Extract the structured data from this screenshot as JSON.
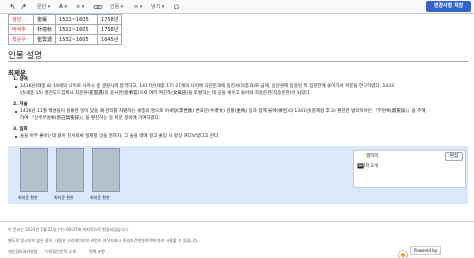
{
  "toolbar": {
    "paragraph_label": "문단",
    "cite_label": "인용",
    "insert_label": "넣기",
    "publish_label": "변경사항 저장"
  },
  "table": {
    "rows": [
      {
        "name": "검암",
        "hanja": "金儼",
        "years": "1522~1605",
        "year2": "1758년"
      },
      {
        "name": "박억추",
        "hanja": "朴億秋",
        "years": "1522~1605",
        "year2": "1758년"
      },
      {
        "name": "최운우",
        "hanja": "崔雲遇",
        "years": "1532~1605",
        "year2": "1645년"
      }
    ]
  },
  "section": {
    "title": "인물 설명",
    "subtitle": "최제운"
  },
  "items": [
    {
      "num": "1. 생애",
      "lines": [
        "1436년(태종 8) 19세의 나이로 사마시 중 생원시에 합격하고, 1417년(태종 17) 27세의 나이에 식년문과에 동진사(의종과)로 급제, 승문원에 등용된 뒤 집현전에 들어가서 학문을 연구하였다. 1433",
        "년(세종 15) 명진도드집제사 최운위(崔雲遇)의 종사관(從事官)으로 여러 여진족(女眞族)을 토벌하는 데 공을 세우고 돌아와 직승문관(직승문관)이 되었다."
      ]
    },
    {
      "num": "2. 저술",
      "lines": [
        "1436년 11월 백성들이 원통한 일이 있을 때 관리를 처벌하는 세종의 명으로 이세형(李世衡) 변효문(卞孝文) 김황(金晄) 등과 함께 율여(律呂)의 1341년(충혜왕 후 2) 편찬한 법의학서인 『무원록(無寃錄)』을 주해",
        "하여 『신주무원록(新註無寃錄)』을 편찬하는 등 학문 정비에 기여하였다."
      ]
    },
    {
      "num": "3. 일화",
      "lines": [
        "술을 아주 좋아는데 왕이 친서로써 절제할 것을 권하자, 그 술을 벽에 걸고 출입 시 항상 쳐다보았다고 한다."
      ]
    }
  ],
  "gallery": {
    "captions": [
      "최지운 편찬",
      "최지운 편찬",
      "최지운 편찬"
    ],
    "card_title": "갤러리",
    "card_count": "이미지 2개",
    "edit_label": "편집"
  },
  "footer": {
    "line1": "이 문서는 2023년 1월 21일 (수) 09:07에 마지막으로 편집되었습니다.",
    "line2": "별도로 명시하지 않은 경우, 내용은 크리에이티브 커먼즈 저작자표시-동일조건변경허락에 따라 사용할 수 있습니다.",
    "links": [
      "개인정보처리방침",
      "디지털인문학 소개",
      "면책 조항"
    ],
    "powered": "Powered by"
  },
  "colors": {
    "accent": "#3366cc",
    "redlink": "#d73333",
    "band": "#d9e8ff"
  },
  "icons": [
    "undo-icon",
    "redo-icon",
    "link-icon",
    "omega-icon",
    "image-icon",
    "gallery-icon",
    "mediawiki-logo"
  ]
}
